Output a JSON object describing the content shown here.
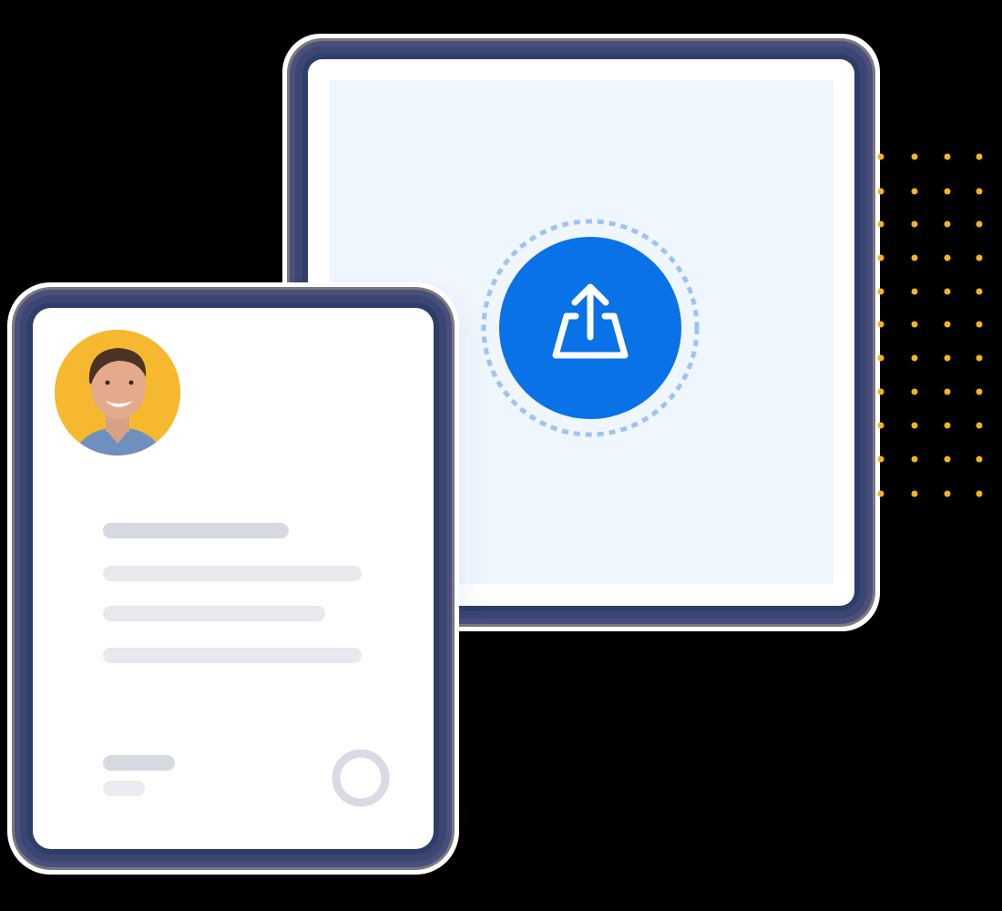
{
  "colors": {
    "background": "#000000",
    "card": "#ffffff",
    "drop_area": "#f0f6fe",
    "upload_button": "#0872e6",
    "dotted_ring": "#9ec4f0",
    "avatar_bg": "#f5b82e",
    "placeholder_dark": "#d7d9e1",
    "placeholder_light": "#e8e9ee",
    "accent_dots": "#f5b31f"
  },
  "icons": {
    "upload": "upload-icon",
    "avatar": "person-photo",
    "status": "ring-icon"
  }
}
